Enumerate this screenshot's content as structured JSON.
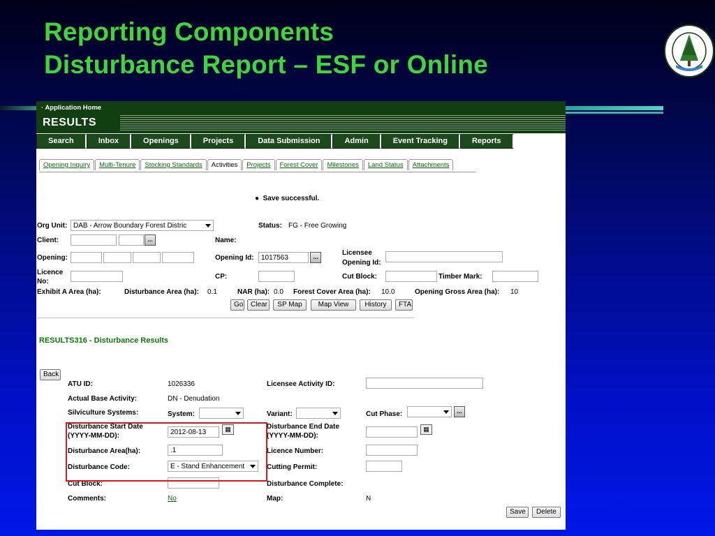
{
  "slide": {
    "title_line1": "Reporting Components",
    "title_line2": "Disturbance Report – ESF or Online",
    "colors": {
      "title": "#3dd63d",
      "background": "#0010c8",
      "highlight": "#e0161a"
    },
    "logo_icon": "forest-service-bc-logo",
    "logo_text_top": "FOREST SERVICE",
    "logo_text_bottom": "BRITISH COLUMBIA"
  },
  "app": {
    "home_link": "· Application Home",
    "brand": "RESULTS",
    "nav": [
      "Search",
      "Inbox",
      "Openings",
      "Projects",
      "Data Submission",
      "Admin",
      "Event Tracking",
      "Reports"
    ],
    "tabs": [
      "Opening Inquiry",
      "Multi-Tenure",
      "Stocking Standards",
      "Activities",
      "Projects",
      "Forest Cover",
      "Milestones",
      "Land Status",
      "Attachments"
    ],
    "active_tab": "Activities",
    "message": "Save successful.",
    "search": {
      "org_unit_label": "Org Unit:",
      "org_unit_value": "DAB - Arrow Boundary Forest Distric",
      "status_label": "Status:",
      "status_value": "FG - Free Growing",
      "client_label": "Client:",
      "name_label": "Name:",
      "opening_label": "Opening:",
      "opening_id_label": "Opening Id:",
      "opening_id_value": "1017563",
      "licensee_opening_label_1": "Licensee",
      "licensee_opening_label_2": "Opening Id:",
      "licence_label_1": "Licence",
      "licence_label_2": "No:",
      "cp_label": "CP:",
      "cut_block_label": "Cut Block:",
      "timber_mark_label": "Timber Mark:",
      "exhibit_label": "Exhibit A Area (ha):",
      "disturbance_area_label": "Disturbance Area (ha):",
      "disturbance_area_value": "0.1",
      "nar_label": "NAR (ha):",
      "nar_value": "0.0",
      "forest_cover_label": "Forest Cover Area (ha):",
      "forest_cover_value": "10.0",
      "gross_area_label": "Opening Gross Area (ha):",
      "gross_area_value": "10",
      "buttons": [
        "Go",
        "Clear",
        "SP Map",
        "Map View",
        "History",
        "FTA"
      ]
    },
    "section_title": "RESULTS316 - Disturbance Results",
    "back_button": "Back",
    "detail": {
      "atu_id_label": "ATU ID:",
      "atu_id_value": "1026336",
      "licensee_activity_label": "Licensee Activity ID:",
      "base_activity_label": "Actual Base Activity:",
      "base_activity_value": "DN - Denudation",
      "silv_systems_label": "Silviculture Systems:",
      "system_label": "System:",
      "variant_label": "Variant:",
      "cut_phase_label": "Cut Phase:",
      "start_date_label_1": "Disturbance Start Date",
      "start_date_label_2": "(YYYY-MM-DD):",
      "start_date_value": "2012-08-13",
      "end_date_label_1": "Disturbance End Date",
      "end_date_label_2": "(YYYY-MM-DD):",
      "area_label": "Disturbance Area(ha):",
      "area_value": ".1",
      "licence_number_label": "Licence Number:",
      "code_label": "Disturbance Code:",
      "code_value": "E - Stand Enhancement",
      "cutting_permit_label": "Cutting Permit:",
      "cut_block_label": "Cut Block:",
      "complete_label": "Disturbance Complete:",
      "comments_label": "Comments:",
      "comments_value": "No",
      "map_label": "Map:",
      "map_value": "N"
    },
    "save_button": "Save",
    "delete_button": "Delete"
  }
}
